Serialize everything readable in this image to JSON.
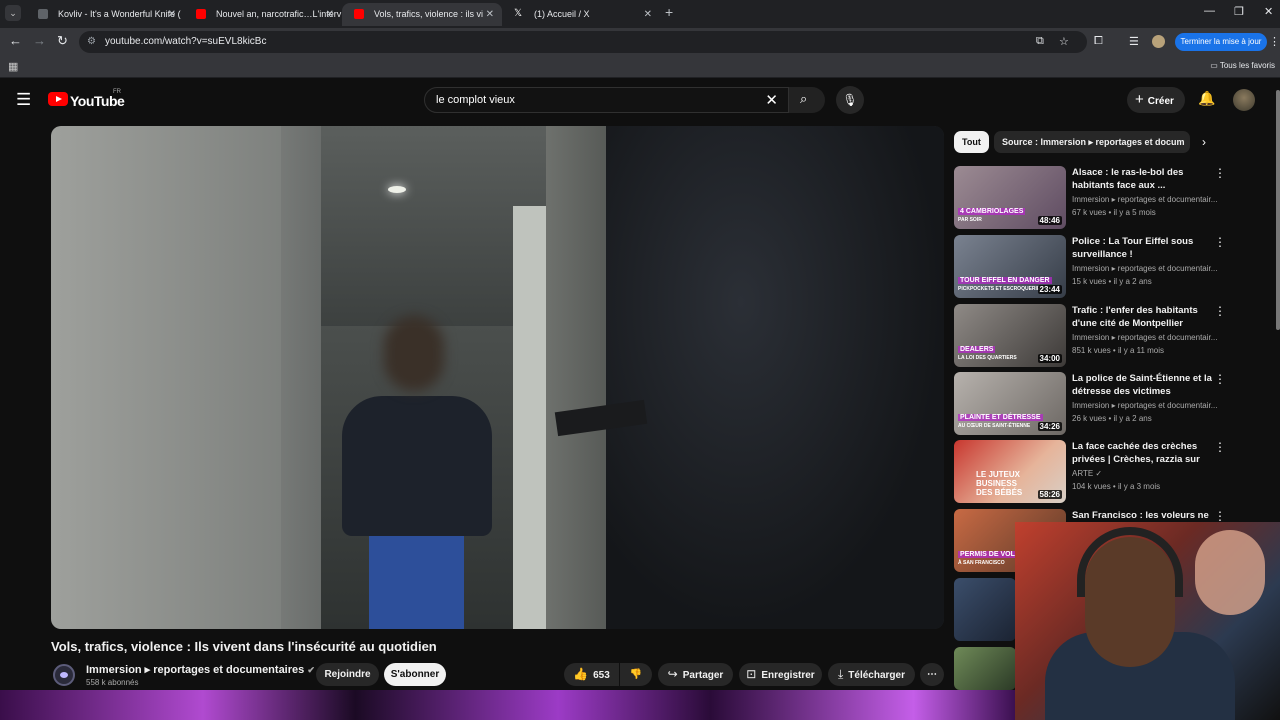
{
  "browser": {
    "tabs": [
      {
        "title": "Kovliv - It's a Wonderful Knife (",
        "favicon_color": "#5f6368",
        "active": false
      },
      {
        "title": "Nouvel an, narcotrafic…L'interv",
        "favicon_color": "#ff0000",
        "active": false
      },
      {
        "title": "Vols, trafics, violence : ils vi",
        "favicon_color": "#ff0000",
        "active": true
      },
      {
        "title": "(1) Accueil / X",
        "favicon_color": "#ffffff",
        "active": false
      }
    ],
    "url": "youtube.com/watch?v=suEVL8kicBc",
    "update_button": "Terminer la mise à jour",
    "bookmarks_all": "Tous les favoris"
  },
  "header": {
    "logo_text": "YouTube",
    "country": "FR",
    "search_value": "le complot vieux",
    "create_label": "Créer"
  },
  "video": {
    "title": "Vols, trafics, violence : Ils vivent dans l'insécurité au quotidien",
    "channel": "Immersion ▸ reportages et documentaires",
    "subscribers": "558 k abonnés",
    "join_label": "Rejoindre",
    "subscribe_label": "S'abonner",
    "likes": "653",
    "share_label": "Partager",
    "save_label": "Enregistrer",
    "download_label": "Télécharger"
  },
  "chips": [
    "Tout",
    "Source : Immersion ▸ reportages et docum"
  ],
  "recommendations": [
    {
      "title": "Alsace : le ras-le-bol des habitants face aux ...",
      "channel": "Immersion ▸ reportages et documentair...",
      "meta": "67 k vues • il y a 5 mois",
      "duration": "48:46",
      "thumb_text": "4 CAMBRIOLAGES",
      "thumb_sub": "PAR SOIR",
      "thumb_color": "#7a6a7c"
    },
    {
      "title": "Police : La Tour Eiffel sous surveillance !",
      "channel": "Immersion ▸ reportages et documentair...",
      "meta": "15 k vues • il y a 2 ans",
      "duration": "23:44",
      "thumb_text": "TOUR EIFFEL EN DANGER",
      "thumb_sub": "PICKPOCKETS ET ESCROQUERIES",
      "thumb_color": "#5b6470"
    },
    {
      "title": "Trafic : l'enfer des habitants d'une cité de Montpellier",
      "channel": "Immersion ▸ reportages et documentair...",
      "meta": "851 k vues • il y a 11 mois",
      "duration": "34:00",
      "thumb_text": "DEALERS",
      "thumb_sub": "LA LOI DES QUARTIERS",
      "thumb_color": "#6c6a66"
    },
    {
      "title": "La police de Saint-Étienne et la détresse des victimes",
      "channel": "Immersion ▸ reportages et documentair...",
      "meta": "26 k vues • il y a 2 ans",
      "duration": "34:26",
      "thumb_text": "PLAINTE ET DÉTRESSE",
      "thumb_sub": "AU CŒUR DE SAINT-ÉTIENNE",
      "thumb_color": "#8e8a86"
    },
    {
      "title": "La face cachée des crèches privées | Crèches, razzia sur le...",
      "channel": "ARTE ✓",
      "meta": "104 k vues • il y a 3 mois",
      "duration": "58:26",
      "thumb_text": "LE JUTEUX BUSINESS DES BÉBÉS",
      "thumb_sub": "",
      "thumb_color": "#b3322c"
    },
    {
      "title": "San Francisco : les voleurs ne",
      "channel": "",
      "meta": "",
      "duration": "",
      "thumb_text": "PERMIS DE VOLER",
      "thumb_sub": "À SAN FRANCISCO",
      "thumb_color": "#a0563a"
    }
  ]
}
